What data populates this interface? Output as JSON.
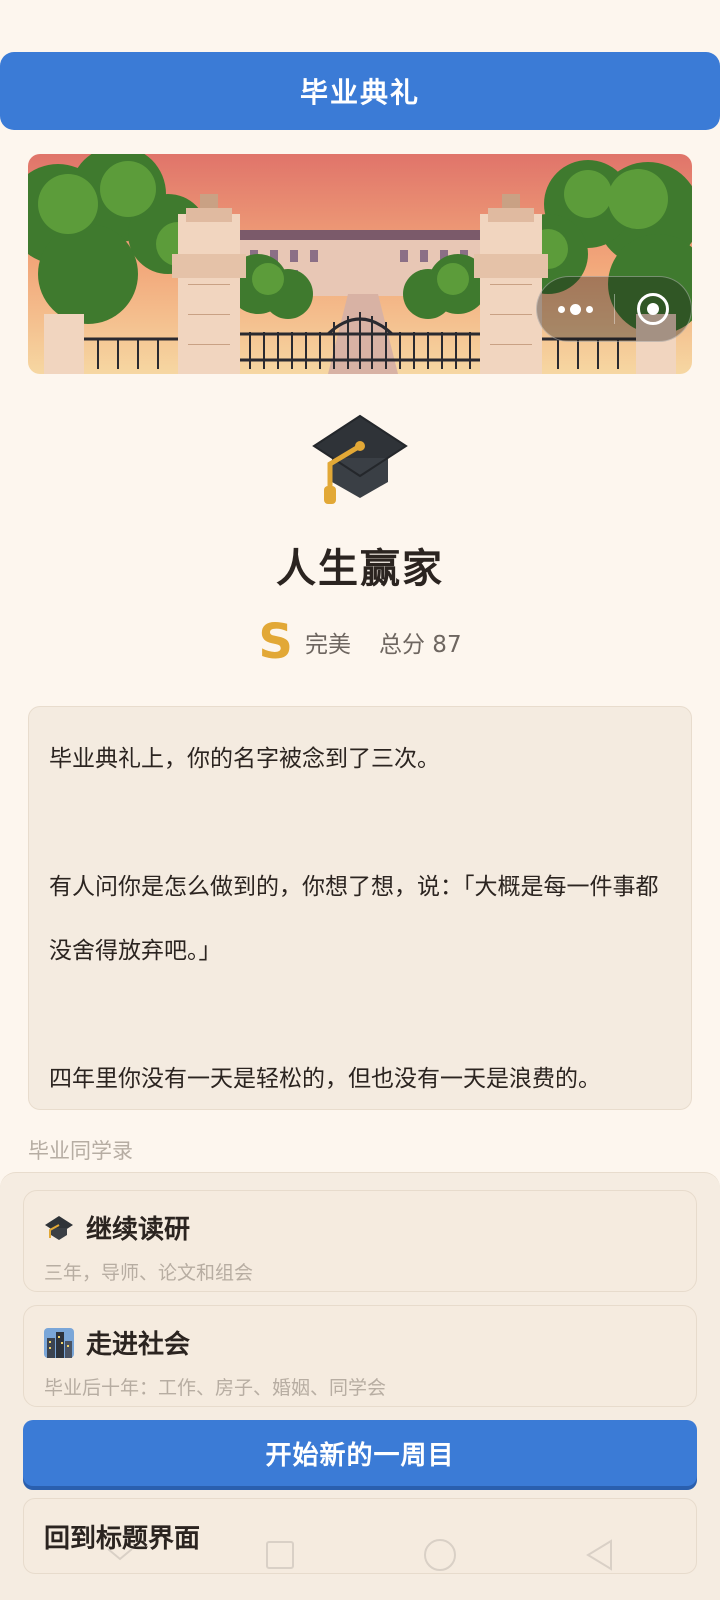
{
  "header": {
    "title": "毕业典礼"
  },
  "banner": {
    "icons": [
      "more-dots-icon",
      "close-capsule-icon"
    ]
  },
  "result": {
    "icon": "graduation-cap-icon",
    "title": "人生赢家",
    "grade": "S",
    "grade_label": "完美",
    "score_text": "总分 87"
  },
  "story": {
    "paragraphs": [
      "毕业典礼上，你的名字被念到了三次。",
      "有人问你是怎么做到的，你想了想，说：「大概是每一件事都没舍得放弃吧。」",
      "四年里你没有一天是轻松的，但也没有一天是浪费的。"
    ]
  },
  "section": {
    "label": "毕业同学录"
  },
  "options": [
    {
      "icon": "graduation-cap-icon",
      "title": "继续读研",
      "subtitle": "三年，导师、论文和组会"
    },
    {
      "icon": "city-buildings-icon",
      "title": "走进社会",
      "subtitle": "毕业后十年：工作、房子、婚姻、同学会"
    }
  ],
  "actions": {
    "new_game": "开始新的一周目",
    "back_to_title": "回到标题界面"
  },
  "colors": {
    "accent": "#3b7bd6",
    "background": "#fdf6ee",
    "grade": "#e2a836"
  },
  "system_nav": [
    "back-chevron-icon",
    "recent-square-icon",
    "home-circle-icon",
    "back-triangle-icon"
  ]
}
